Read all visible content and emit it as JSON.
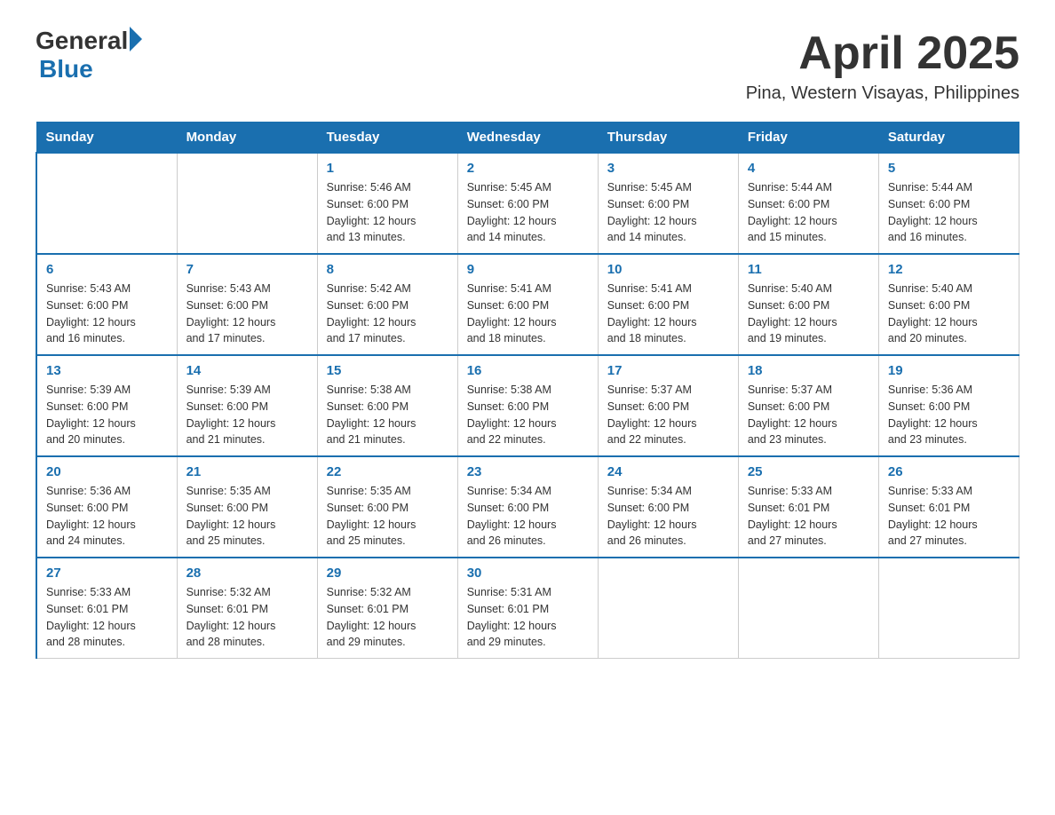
{
  "logo": {
    "general": "General",
    "blue": "Blue"
  },
  "title": "April 2025",
  "location": "Pina, Western Visayas, Philippines",
  "days_of_week": [
    "Sunday",
    "Monday",
    "Tuesday",
    "Wednesday",
    "Thursday",
    "Friday",
    "Saturday"
  ],
  "weeks": [
    [
      {
        "day": "",
        "info": ""
      },
      {
        "day": "",
        "info": ""
      },
      {
        "day": "1",
        "info": "Sunrise: 5:46 AM\nSunset: 6:00 PM\nDaylight: 12 hours\nand 13 minutes."
      },
      {
        "day": "2",
        "info": "Sunrise: 5:45 AM\nSunset: 6:00 PM\nDaylight: 12 hours\nand 14 minutes."
      },
      {
        "day": "3",
        "info": "Sunrise: 5:45 AM\nSunset: 6:00 PM\nDaylight: 12 hours\nand 14 minutes."
      },
      {
        "day": "4",
        "info": "Sunrise: 5:44 AM\nSunset: 6:00 PM\nDaylight: 12 hours\nand 15 minutes."
      },
      {
        "day": "5",
        "info": "Sunrise: 5:44 AM\nSunset: 6:00 PM\nDaylight: 12 hours\nand 16 minutes."
      }
    ],
    [
      {
        "day": "6",
        "info": "Sunrise: 5:43 AM\nSunset: 6:00 PM\nDaylight: 12 hours\nand 16 minutes."
      },
      {
        "day": "7",
        "info": "Sunrise: 5:43 AM\nSunset: 6:00 PM\nDaylight: 12 hours\nand 17 minutes."
      },
      {
        "day": "8",
        "info": "Sunrise: 5:42 AM\nSunset: 6:00 PM\nDaylight: 12 hours\nand 17 minutes."
      },
      {
        "day": "9",
        "info": "Sunrise: 5:41 AM\nSunset: 6:00 PM\nDaylight: 12 hours\nand 18 minutes."
      },
      {
        "day": "10",
        "info": "Sunrise: 5:41 AM\nSunset: 6:00 PM\nDaylight: 12 hours\nand 18 minutes."
      },
      {
        "day": "11",
        "info": "Sunrise: 5:40 AM\nSunset: 6:00 PM\nDaylight: 12 hours\nand 19 minutes."
      },
      {
        "day": "12",
        "info": "Sunrise: 5:40 AM\nSunset: 6:00 PM\nDaylight: 12 hours\nand 20 minutes."
      }
    ],
    [
      {
        "day": "13",
        "info": "Sunrise: 5:39 AM\nSunset: 6:00 PM\nDaylight: 12 hours\nand 20 minutes."
      },
      {
        "day": "14",
        "info": "Sunrise: 5:39 AM\nSunset: 6:00 PM\nDaylight: 12 hours\nand 21 minutes."
      },
      {
        "day": "15",
        "info": "Sunrise: 5:38 AM\nSunset: 6:00 PM\nDaylight: 12 hours\nand 21 minutes."
      },
      {
        "day": "16",
        "info": "Sunrise: 5:38 AM\nSunset: 6:00 PM\nDaylight: 12 hours\nand 22 minutes."
      },
      {
        "day": "17",
        "info": "Sunrise: 5:37 AM\nSunset: 6:00 PM\nDaylight: 12 hours\nand 22 minutes."
      },
      {
        "day": "18",
        "info": "Sunrise: 5:37 AM\nSunset: 6:00 PM\nDaylight: 12 hours\nand 23 minutes."
      },
      {
        "day": "19",
        "info": "Sunrise: 5:36 AM\nSunset: 6:00 PM\nDaylight: 12 hours\nand 23 minutes."
      }
    ],
    [
      {
        "day": "20",
        "info": "Sunrise: 5:36 AM\nSunset: 6:00 PM\nDaylight: 12 hours\nand 24 minutes."
      },
      {
        "day": "21",
        "info": "Sunrise: 5:35 AM\nSunset: 6:00 PM\nDaylight: 12 hours\nand 25 minutes."
      },
      {
        "day": "22",
        "info": "Sunrise: 5:35 AM\nSunset: 6:00 PM\nDaylight: 12 hours\nand 25 minutes."
      },
      {
        "day": "23",
        "info": "Sunrise: 5:34 AM\nSunset: 6:00 PM\nDaylight: 12 hours\nand 26 minutes."
      },
      {
        "day": "24",
        "info": "Sunrise: 5:34 AM\nSunset: 6:00 PM\nDaylight: 12 hours\nand 26 minutes."
      },
      {
        "day": "25",
        "info": "Sunrise: 5:33 AM\nSunset: 6:01 PM\nDaylight: 12 hours\nand 27 minutes."
      },
      {
        "day": "26",
        "info": "Sunrise: 5:33 AM\nSunset: 6:01 PM\nDaylight: 12 hours\nand 27 minutes."
      }
    ],
    [
      {
        "day": "27",
        "info": "Sunrise: 5:33 AM\nSunset: 6:01 PM\nDaylight: 12 hours\nand 28 minutes."
      },
      {
        "day": "28",
        "info": "Sunrise: 5:32 AM\nSunset: 6:01 PM\nDaylight: 12 hours\nand 28 minutes."
      },
      {
        "day": "29",
        "info": "Sunrise: 5:32 AM\nSunset: 6:01 PM\nDaylight: 12 hours\nand 29 minutes."
      },
      {
        "day": "30",
        "info": "Sunrise: 5:31 AM\nSunset: 6:01 PM\nDaylight: 12 hours\nand 29 minutes."
      },
      {
        "day": "",
        "info": ""
      },
      {
        "day": "",
        "info": ""
      },
      {
        "day": "",
        "info": ""
      }
    ]
  ]
}
